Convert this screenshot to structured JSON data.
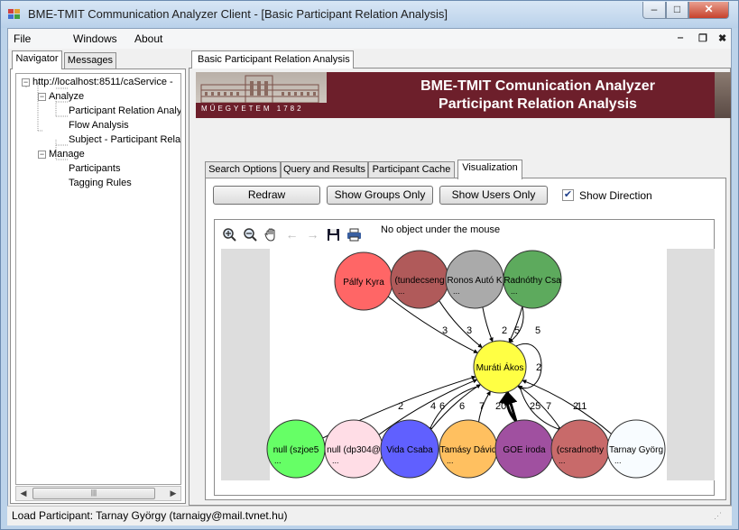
{
  "window": {
    "title": "BME-TMIT Communication Analyzer Client - [Basic Participant Relation Analysis]",
    "minimize": "‒",
    "maximize": "□",
    "close": "✕"
  },
  "menu": {
    "file": "File",
    "windows": "Windows",
    "about": "About",
    "mdi_minimize": "‒",
    "mdi_restore": "❐",
    "mdi_close": "✖"
  },
  "left_tabs": {
    "navigator": "Navigator",
    "messages": "Messages"
  },
  "tree": {
    "root": "http://localhost:8511/caService -",
    "analyze": "Analyze",
    "analyze_items": [
      "Participant Relation Analys",
      "Flow Analysis",
      "Subject - Participant Relat"
    ],
    "manage": "Manage",
    "manage_items": [
      "Participants",
      "Tagging Rules"
    ]
  },
  "doc_tab": "Basic Participant Relation Analysis",
  "banner": {
    "line1": "BME-TMIT Comunication Analyzer",
    "line2": "Participant Relation Analysis",
    "motto": "MŰEGYETEM 1782"
  },
  "inner_tabs": [
    "Search Options",
    "Query and Results",
    "Participant  Cache",
    "Visualization"
  ],
  "buttons": {
    "redraw": "Redraw",
    "show_groups": "Show Groups Only",
    "show_users": "Show Users Only",
    "show_direction": "Show Direction",
    "show_direction_checked": true
  },
  "viz": {
    "hover_status": "No object under the mouse",
    "toolbar": [
      "zoom-in-icon",
      "zoom-out-icon",
      "pan-hand-icon",
      "back-arrow-icon",
      "forward-arrow-icon",
      "save-icon",
      "print-icon"
    ]
  },
  "graph": {
    "center": {
      "label": "Muráti Ákos",
      "color": "#ffff44",
      "self_loop": "2"
    },
    "top_nodes": [
      {
        "label": "Pálfy Kyra",
        "color": "#ff6666",
        "sub": "",
        "edge": "3"
      },
      {
        "label": "(tundecseng",
        "color": "#b05a5a",
        "sub": "...",
        "edge": "3"
      },
      {
        "label": "Ronos Autó K",
        "color": "#aaaaaa",
        "sub": "...",
        "edge": "2"
      },
      {
        "label": "Radnóthy Csa",
        "color": "#5daa5d",
        "sub": "...",
        "edge": "5"
      }
    ],
    "top_extra_edge": "5",
    "bottom_nodes": [
      {
        "label": "null (szjoe5",
        "color": "#66ff66",
        "sub": "...",
        "edge": "2"
      },
      {
        "label": "null (dp304@",
        "color": "#ffdde6",
        "sub": "...",
        "edge": "4"
      },
      {
        "label": "Vida Csaba",
        "color": "#6060ff",
        "sub": "",
        "edge": "6"
      },
      {
        "label": "Tamásy Dávid",
        "color": "#ffc060",
        "sub": "...",
        "edge": "7"
      },
      {
        "label": "GOE iroda",
        "color": "#a050a0",
        "sub": "",
        "edge": "20"
      },
      {
        "label": "(csradnothy",
        "color": "#c86a6a",
        "sub": "...",
        "edge": "7"
      },
      {
        "label": "Tarnay Györg",
        "color": "#f8fcff",
        "sub": "...",
        "edge": "2"
      }
    ],
    "bottom_extra_edges": [
      "6",
      "25",
      "11"
    ]
  },
  "statusbar": "Load Participant: Tarnay György (tarnaigy@mail.tvnet.hu)"
}
